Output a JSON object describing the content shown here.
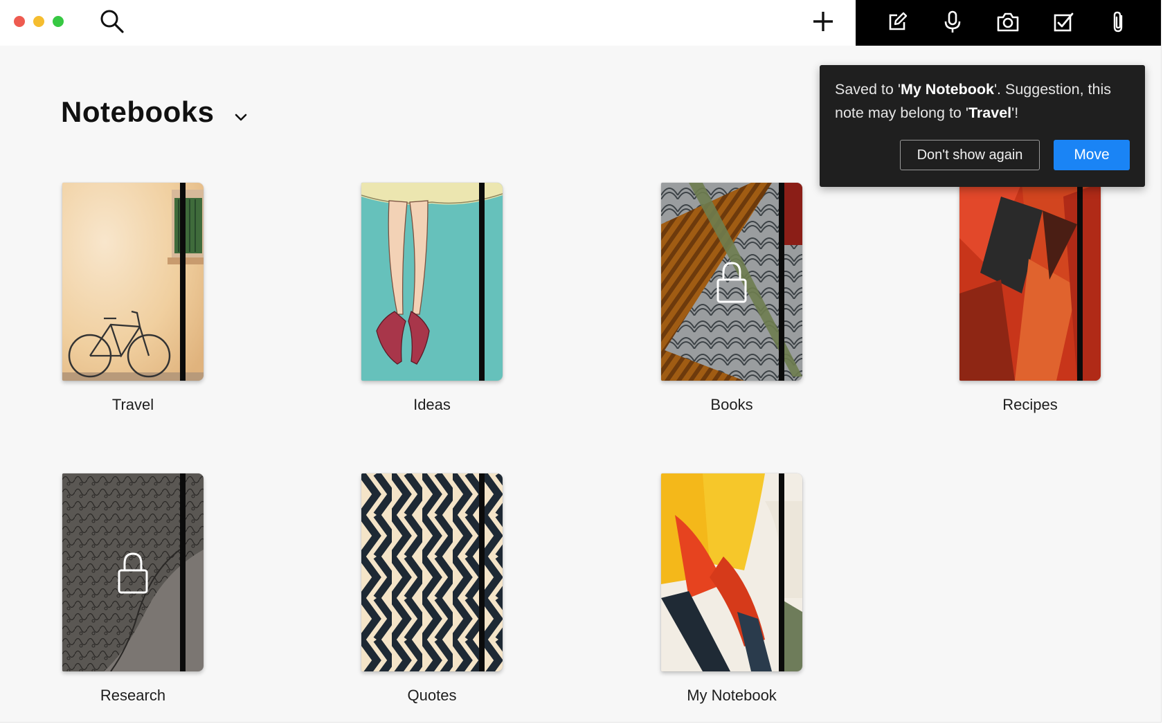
{
  "window": {
    "controls": [
      "close",
      "minimize",
      "zoom"
    ]
  },
  "toolbar": {
    "left_icons": [
      "search-icon"
    ],
    "add_icon": "plus-icon",
    "tools": [
      "compose-icon",
      "microphone-icon",
      "camera-icon",
      "checkbox-icon",
      "paperclip-icon"
    ]
  },
  "header": {
    "title": "Notebooks",
    "chevron_icon": "chevron-down-icon"
  },
  "notebooks": [
    {
      "label": "Travel",
      "locked": false
    },
    {
      "label": "Ideas",
      "locked": false
    },
    {
      "label": "Books",
      "locked": true
    },
    {
      "label": "Recipes",
      "locked": false
    },
    {
      "label": "Research",
      "locked": true
    },
    {
      "label": "Quotes",
      "locked": false
    },
    {
      "label": "My Notebook",
      "locked": false
    }
  ],
  "toast": {
    "msg_prefix": "Saved to '",
    "saved_notebook": "My Notebook",
    "msg_middle": "'. Suggestion, this note may belong to '",
    "suggested_notebook": "Travel",
    "msg_suffix": "'!",
    "dismiss_label": "Don't show again",
    "move_label": "Move"
  },
  "colors": {
    "accent": "#1a84f5",
    "toast_bg": "#1f1f1f",
    "toolbar_bg": "#000000",
    "close": "#ee5b50",
    "minimize": "#f5bd2f",
    "zoom": "#37c843"
  }
}
